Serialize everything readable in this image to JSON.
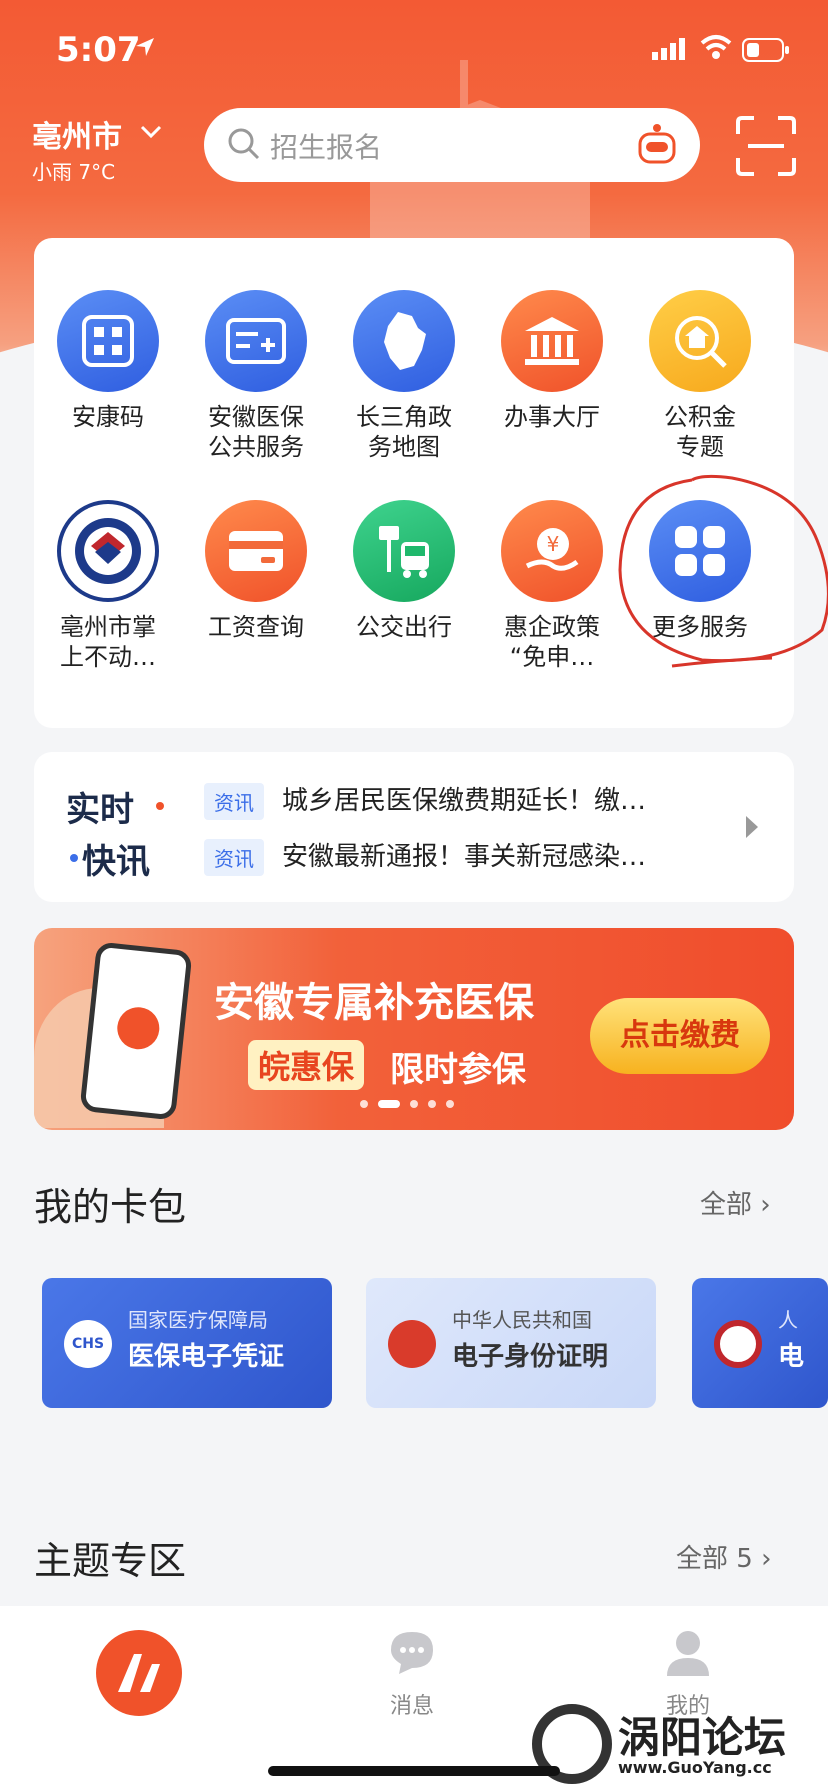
{
  "status_bar": {
    "time": "5:07"
  },
  "header": {
    "city": "亳州市",
    "weather": "小雨 7°C",
    "search_placeholder": "招生报名"
  },
  "services": [
    {
      "label": "安康码",
      "icon": "qr-code-icon",
      "color": "blue"
    },
    {
      "label": "安徽医保\n公共服务",
      "icon": "medical-card-icon",
      "color": "blue"
    },
    {
      "label": "长三角政\n务地图",
      "icon": "map-icon",
      "color": "blue"
    },
    {
      "label": "办事大厅",
      "icon": "government-building-icon",
      "color": "orange"
    },
    {
      "label": "公积金\n专题",
      "icon": "housing-fund-icon",
      "color": "yellow"
    },
    {
      "label": "亳州市掌\n上不动…",
      "icon": "real-estate-registration-icon",
      "color": "seal"
    },
    {
      "label": "工资查询",
      "icon": "wallet-card-icon",
      "color": "orange"
    },
    {
      "label": "公交出行",
      "icon": "bus-icon",
      "color": "green"
    },
    {
      "label": "惠企政策\n“免申…",
      "icon": "yuan-hand-icon",
      "color": "orange"
    },
    {
      "label": "更多服务",
      "icon": "grid-icon",
      "color": "blue"
    }
  ],
  "news": {
    "logo_line1": "实时",
    "logo_line2": "快讯",
    "items": [
      {
        "tag": "资讯",
        "text": "城乡居民医保缴费期延长！缴…"
      },
      {
        "tag": "资讯",
        "text": "安徽最新通报！事关新冠感染…"
      }
    ]
  },
  "banner": {
    "title": "安徽专属补充医保",
    "tag": "皖惠保",
    "subtitle": "限时参保",
    "button": "点击缴费"
  },
  "wallet": {
    "title": "我的卡包",
    "all_label": "全部",
    "cards": [
      {
        "sub": "国家医疗保障局",
        "main": "医保电子凭证",
        "logo_text": "CHS"
      },
      {
        "sub": "中华人民共和国",
        "main": "电子身份证明"
      },
      {
        "sub": "人",
        "main": "电"
      }
    ]
  },
  "topics": {
    "title": "主题专区",
    "all_label": "全部 5"
  },
  "tabbar": {
    "items": [
      {
        "label": "",
        "icon": "home-logo-icon"
      },
      {
        "label": "消息",
        "icon": "message-icon"
      },
      {
        "label": "我的",
        "icon": "profile-icon"
      }
    ]
  },
  "watermark": {
    "text": "涡阳论坛",
    "url": "www.GuoYang.cc"
  },
  "colors": {
    "primary": "#f0522a",
    "accent_blue": "#3b6ee8"
  }
}
